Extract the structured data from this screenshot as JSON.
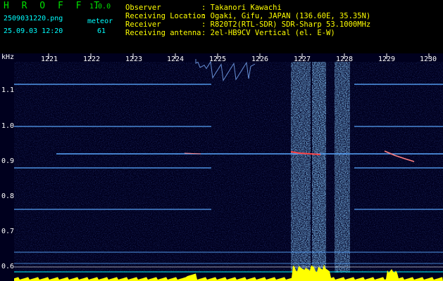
{
  "header": {
    "app_title": "H R O F F T",
    "app_version": "1.0.0",
    "file_name": "2509031220.png",
    "mode_label": "meteor",
    "date_time": "25.09.03 12:20",
    "meteor_count": "61",
    "info": [
      {
        "label": "Observer",
        "value": ": Takanori Kawachi"
      },
      {
        "label": "Receiving Location",
        "value": ": Ogaki, Gifu, JAPAN (136.60E, 35.35N)"
      },
      {
        "label": "Receiver",
        "value": ": R820T2(RTL-SDR) SDR-Sharp 53.1000MHz"
      },
      {
        "label": "Receiving antenna",
        "value": ": 2el-HB9CV Vertical (el. E-W)"
      }
    ]
  },
  "spectrogram": {
    "unit_label": "kHz",
    "x_ticks": [
      "1221",
      "1222",
      "1223",
      "1224",
      "1225",
      "1226",
      "1227",
      "1228",
      "1229",
      "1230"
    ],
    "y_ticks": [
      "1.1",
      "1.0",
      "0.9",
      "0.8",
      "0.7",
      "0.6"
    ],
    "colors": {
      "background": "#00001e",
      "carrier": "#5aa8ff",
      "signal": "#ff4040",
      "spectrum": "#ffff00",
      "baseline": "#00ffff"
    }
  }
}
